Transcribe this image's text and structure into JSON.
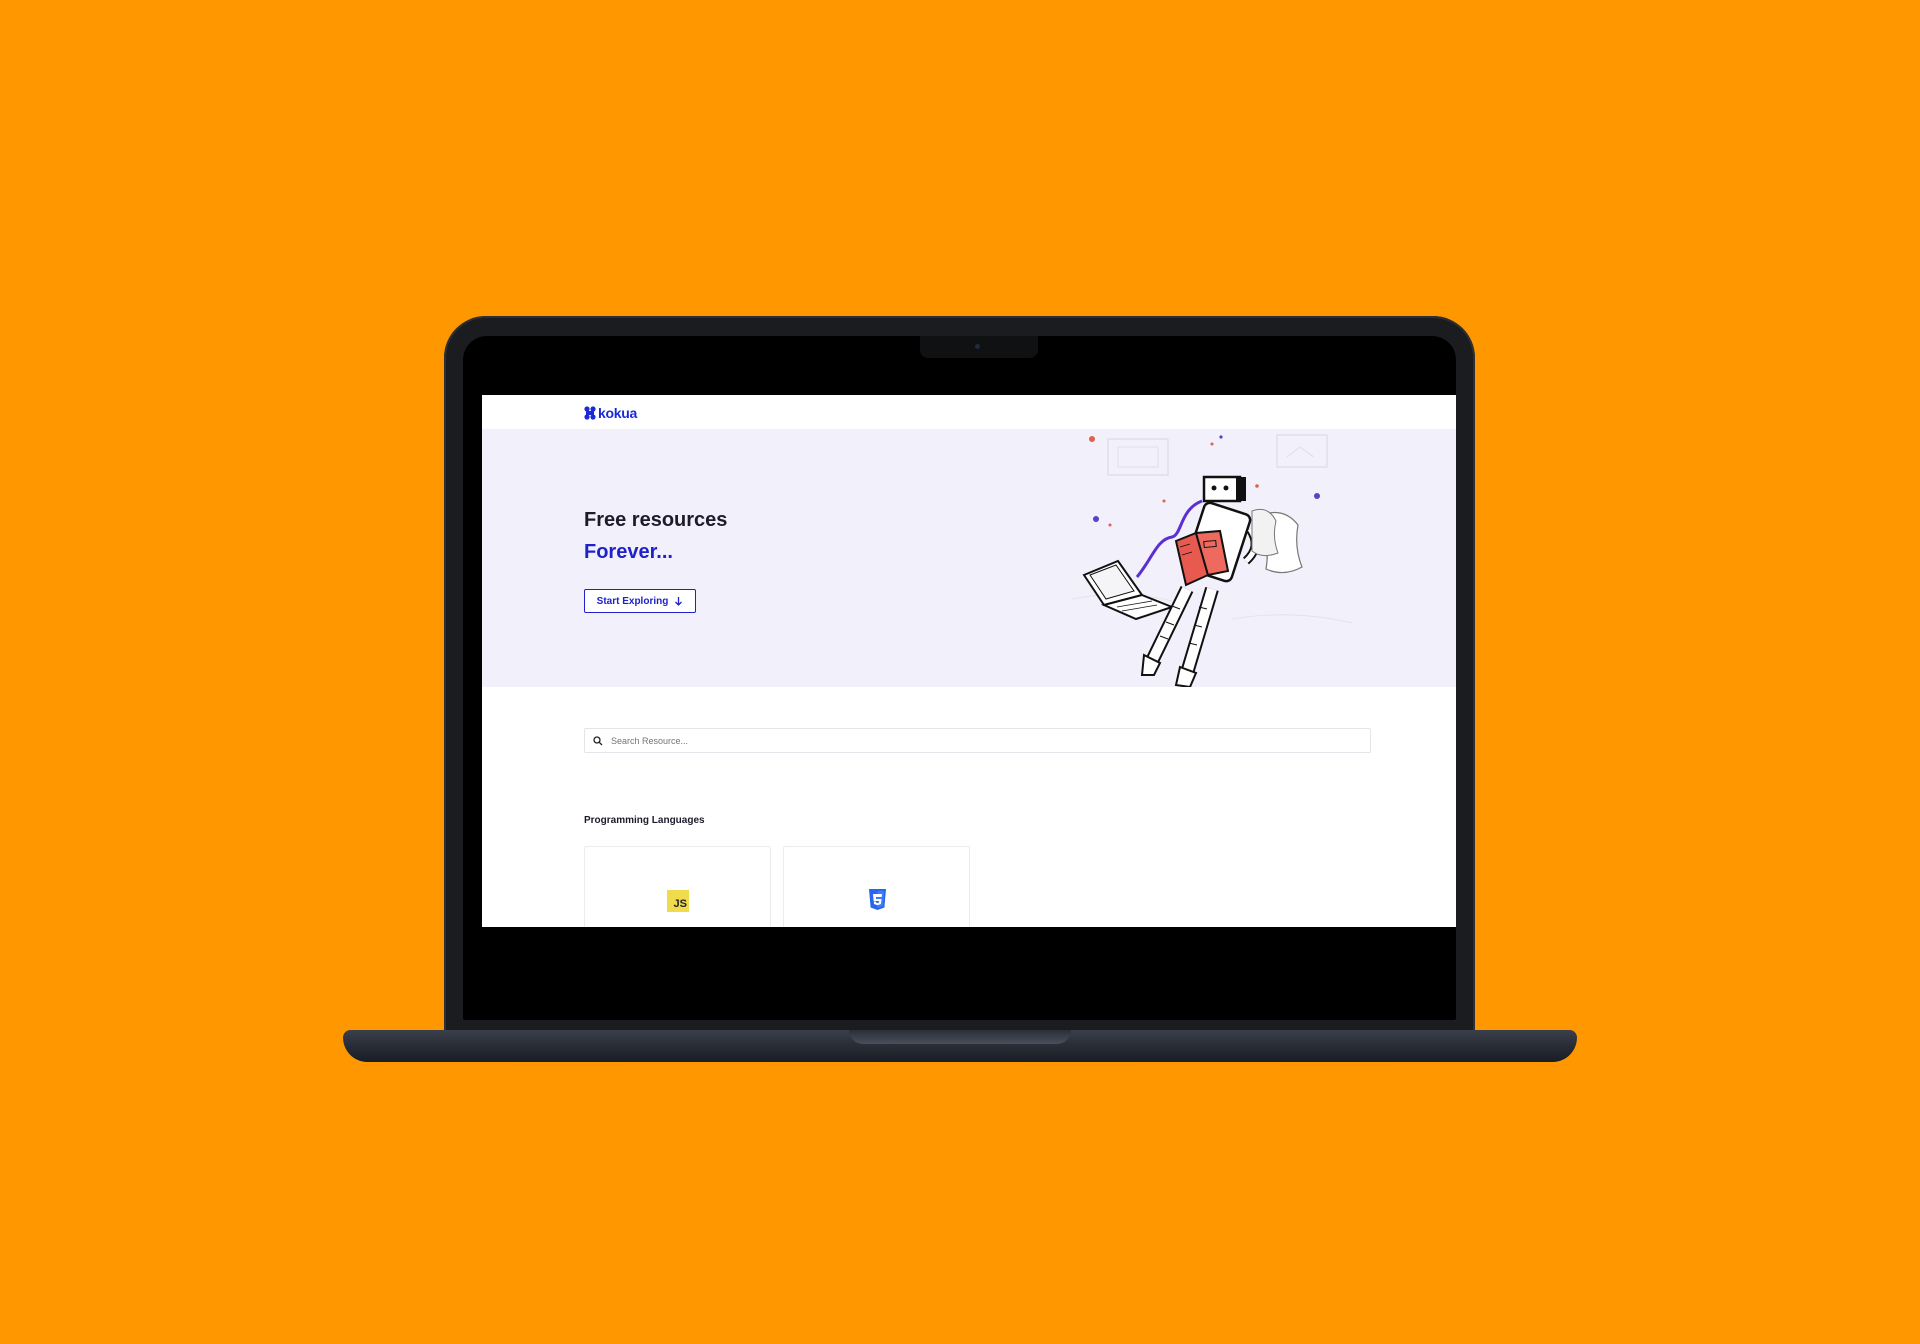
{
  "site": {
    "logo_text": "kokua",
    "hero": {
      "title": "Free resources",
      "subtitle": "Forever...",
      "cta_label": "Start Exploring"
    },
    "search": {
      "placeholder": "Search Resource..."
    },
    "sections": [
      {
        "title": "Programming Languages",
        "cards": [
          {
            "icon": "javascript-icon",
            "icon_text": "JS"
          },
          {
            "icon": "css3-icon"
          }
        ]
      }
    ]
  },
  "colors": {
    "background": "#FF9800",
    "brand_blue": "#1f22c9",
    "hero_bg": "#f1f0fb",
    "js_yellow": "#f0db4f",
    "css_blue": "#2965f1"
  }
}
